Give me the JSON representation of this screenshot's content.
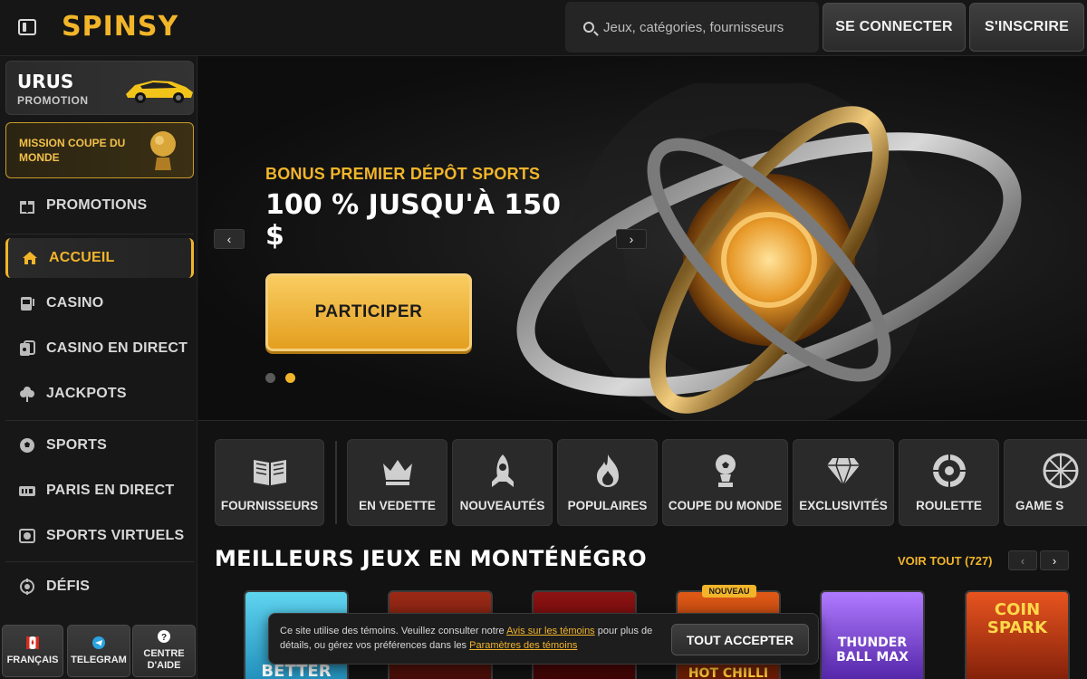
{
  "header": {
    "logo": "SPINSY",
    "search_placeholder": "Jeux, catégories, fournisseurs",
    "login_label": "SE CONNECTER",
    "signup_label": "S'INSCRIRE"
  },
  "sidebar": {
    "promo_urus": {
      "title": "URUS",
      "subtitle": "PROMOTION"
    },
    "promo_mission": {
      "title": "MISSION COUPE DU MONDE"
    },
    "items": [
      {
        "label": "PROMOTIONS",
        "icon": "gift-icon"
      },
      {
        "label": "ACCUEIL",
        "icon": "home-icon",
        "active": true
      },
      {
        "label": "CASINO",
        "icon": "slot-machine-icon"
      },
      {
        "label": "CASINO EN DIRECT",
        "icon": "live-casino-icon"
      },
      {
        "label": "JACKPOTS",
        "icon": "clover-icon"
      },
      {
        "label": "SPORTS",
        "icon": "soccer-ball-icon"
      },
      {
        "label": "PARIS EN DIRECT",
        "icon": "live-badge-icon"
      },
      {
        "label": "SPORTS VIRTUELS",
        "icon": "virtual-sports-icon"
      },
      {
        "label": "DÉFIS",
        "icon": "challenge-icon"
      }
    ],
    "bottom": [
      {
        "label": "FRANÇAIS",
        "icon": "canada-flag-icon"
      },
      {
        "label": "TELEGRAM",
        "icon": "telegram-icon"
      },
      {
        "label": "CENTRE D'AIDE",
        "icon": "help-icon"
      }
    ]
  },
  "hero": {
    "eyebrow": "BONUS PREMIER DÉPÔT SPORTS",
    "title": "100 % JUSQU'À 150 $",
    "cta": "PARTICIPER",
    "prev": "‹",
    "next": "›",
    "slides": 2,
    "active_slide": 2
  },
  "categories": [
    {
      "label": "FOURNISSEURS",
      "icon": "book-icon"
    },
    {
      "label": "EN VEDETTE",
      "icon": "crown-icon"
    },
    {
      "label": "NOUVEAUTÉS",
      "icon": "rocket-icon"
    },
    {
      "label": "POPULAIRES",
      "icon": "flame-icon"
    },
    {
      "label": "COUPE DU MONDE",
      "icon": "trophy-icon"
    },
    {
      "label": "EXCLUSIVITÉS",
      "icon": "diamond-icon"
    },
    {
      "label": "ROULETTE",
      "icon": "roulette-icon"
    },
    {
      "label": "GAME S",
      "icon": "game-show-icon"
    }
  ],
  "games_section": {
    "title": "MEILLEURS JEUX EN MONTÉNÉGRO",
    "see_all": "VOIR TOUT (727)",
    "prev": "‹",
    "next": "›",
    "new_badge": "NOUVEAU",
    "games": [
      {
        "name": "BETTER",
        "color": "#2fb0d8"
      },
      {
        "name": "",
        "color": "#8a1a10"
      },
      {
        "name": "",
        "color": "#7a0d0d"
      },
      {
        "name": "HOT CHILLI",
        "color": "#b02a0a"
      },
      {
        "name": "THUNDER BALL MAX",
        "color": "#7b3cd0"
      },
      {
        "name": "COIN SPARK",
        "color": "#c8401c"
      }
    ]
  },
  "cookie": {
    "text_before": "Ce site utilise des témoins. Veuillez consulter notre ",
    "link1": "Avis sur les témoins",
    "text_middle": " pour plus de détails, ou gérez vos préférences dans les ",
    "link2": "Paramètres des témoins",
    "accept": "TOUT ACCEPTER"
  },
  "colors": {
    "accent": "#f2b52a",
    "background": "#121212"
  }
}
